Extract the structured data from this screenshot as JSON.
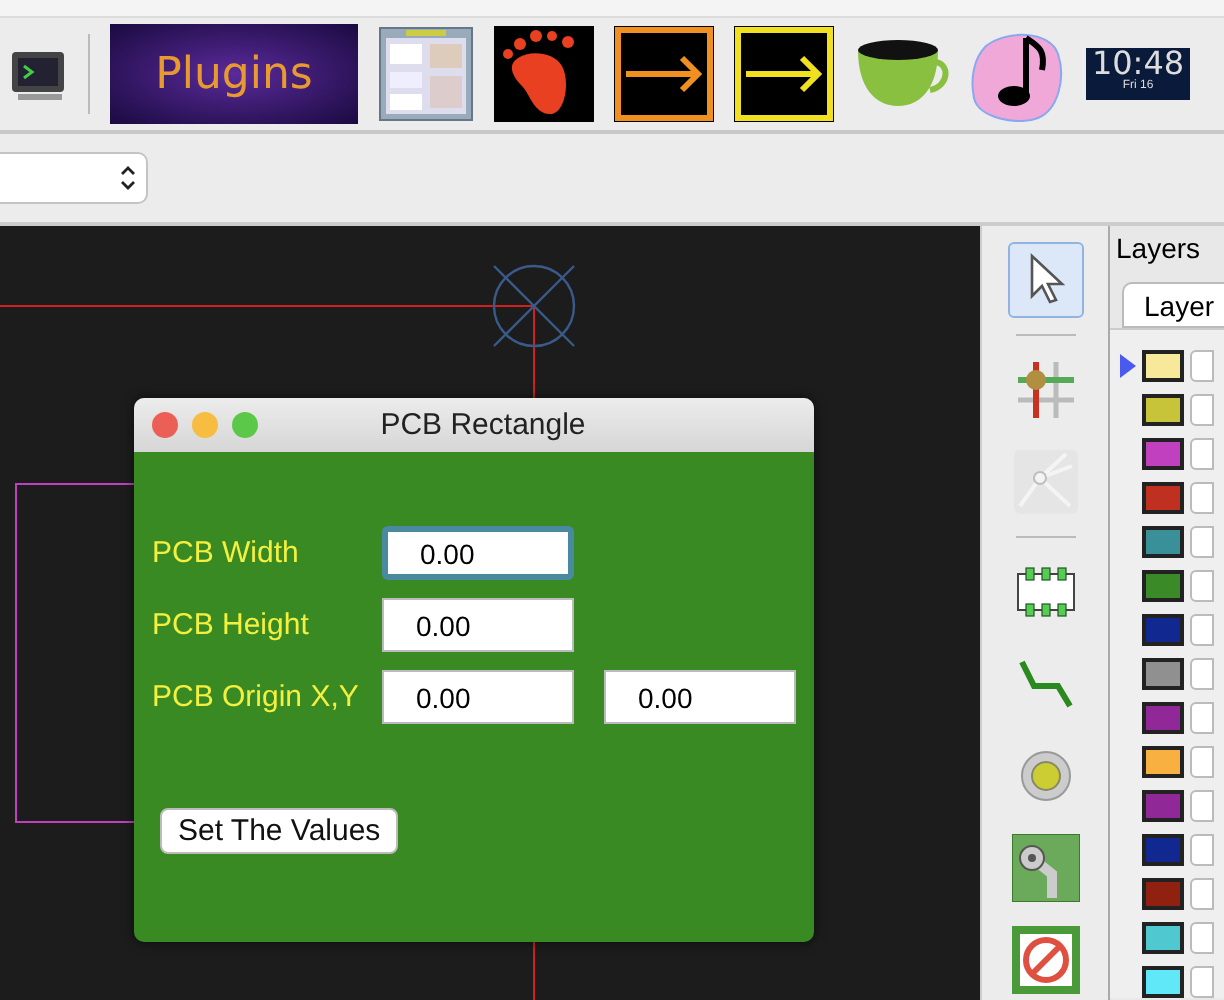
{
  "toolbar": {
    "plugins_label": "Plugins",
    "clock": {
      "time": "10:48",
      "date": "Fri 16"
    }
  },
  "dialog": {
    "title": "PCB Rectangle",
    "rows": [
      {
        "label": "PCB Width",
        "fields": [
          {
            "value": "0.00",
            "focused": true
          }
        ]
      },
      {
        "label": "PCB Height",
        "fields": [
          {
            "value": "0.00",
            "focused": false
          }
        ]
      },
      {
        "label": "PCB Origin X,Y",
        "fields": [
          {
            "value": "0.00",
            "focused": false
          },
          {
            "value": "0.00",
            "focused": false
          }
        ]
      }
    ],
    "button": "Set The Values"
  },
  "tool_groups": [
    [
      {
        "kind": "pointer",
        "selected": true,
        "disabled": false
      }
    ],
    [
      {
        "kind": "grid",
        "selected": false,
        "disabled": false
      },
      {
        "kind": "radial",
        "selected": false,
        "disabled": true
      }
    ],
    [
      {
        "kind": "chip",
        "selected": false,
        "disabled": false
      },
      {
        "kind": "trace",
        "selected": false,
        "disabled": false
      },
      {
        "kind": "via",
        "selected": false,
        "disabled": false
      },
      {
        "kind": "pad",
        "selected": false,
        "disabled": false
      },
      {
        "kind": "keepout",
        "selected": false,
        "disabled": false
      }
    ]
  ],
  "layers": {
    "title": "Layers",
    "tab": "Layer",
    "items": [
      {
        "color": "#f8e89a",
        "selected": true
      },
      {
        "color": "#c8c43a",
        "selected": false
      },
      {
        "color": "#c040c0",
        "selected": false
      },
      {
        "color": "#c03020",
        "selected": false
      },
      {
        "color": "#3a9098",
        "selected": false
      },
      {
        "color": "#3a8a28",
        "selected": false
      },
      {
        "color": "#102890",
        "selected": false
      },
      {
        "color": "#909090",
        "selected": false
      },
      {
        "color": "#902898",
        "selected": false
      },
      {
        "color": "#f8b040",
        "selected": false
      },
      {
        "color": "#902898",
        "selected": false
      },
      {
        "color": "#102890",
        "selected": false
      },
      {
        "color": "#902010",
        "selected": false
      },
      {
        "color": "#50c8d0",
        "selected": false
      },
      {
        "color": "#60e8f8",
        "selected": false
      }
    ]
  }
}
